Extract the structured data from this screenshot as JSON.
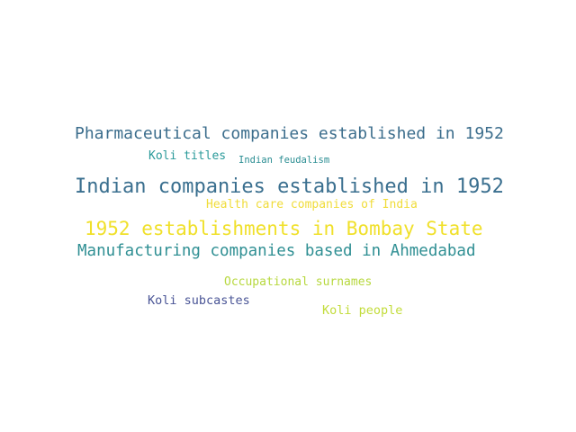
{
  "words": [
    {
      "text": "Pharmaceutical companies established in 1952",
      "color": "#3b6d8c"
    },
    {
      "text": "Koli titles",
      "color": "#2a9a9a"
    },
    {
      "text": "Indian feudalism",
      "color": "#2a8d92"
    },
    {
      "text": "Indian companies established in 1952",
      "color": "#3a6f8f"
    },
    {
      "text": "Health care companies of India",
      "color": "#f0dc3a"
    },
    {
      "text": "1952 establishments in Bombay State",
      "color": "#f0e02a"
    },
    {
      "text": "Manufacturing companies based in Ahmedabad",
      "color": "#2f8f93"
    },
    {
      "text": "Occupational surnames",
      "color": "#b7d83f"
    },
    {
      "text": "Koli subcastes",
      "color": "#4a5596"
    },
    {
      "text": "Koli people",
      "color": "#c2dc3a"
    }
  ]
}
